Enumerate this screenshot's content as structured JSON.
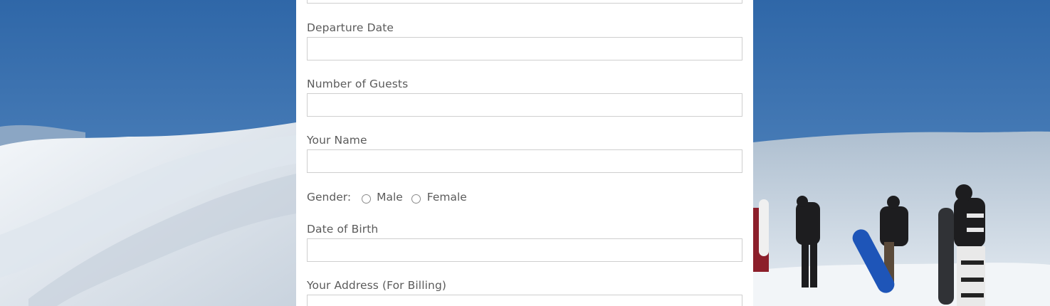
{
  "form": {
    "fields": [
      {
        "label": "",
        "value": ""
      },
      {
        "label": "Departure Date",
        "value": ""
      },
      {
        "label": "Number of Guests",
        "value": ""
      },
      {
        "label": "Your Name",
        "value": ""
      },
      {
        "label": "Date of Birth",
        "value": ""
      },
      {
        "label": "Your Address (For Billing)",
        "value": ""
      }
    ],
    "gender": {
      "label": "Gender:",
      "options": [
        "Male",
        "Female"
      ],
      "selected": null
    }
  },
  "colors": {
    "sky": "#4478b2",
    "snow": "#e9eef3",
    "panel": "#ffffff",
    "field_border": "#cfcfcf",
    "label_text": "#5b5b5b"
  },
  "icons": {
    "radio_unchecked": "radio-icon"
  }
}
